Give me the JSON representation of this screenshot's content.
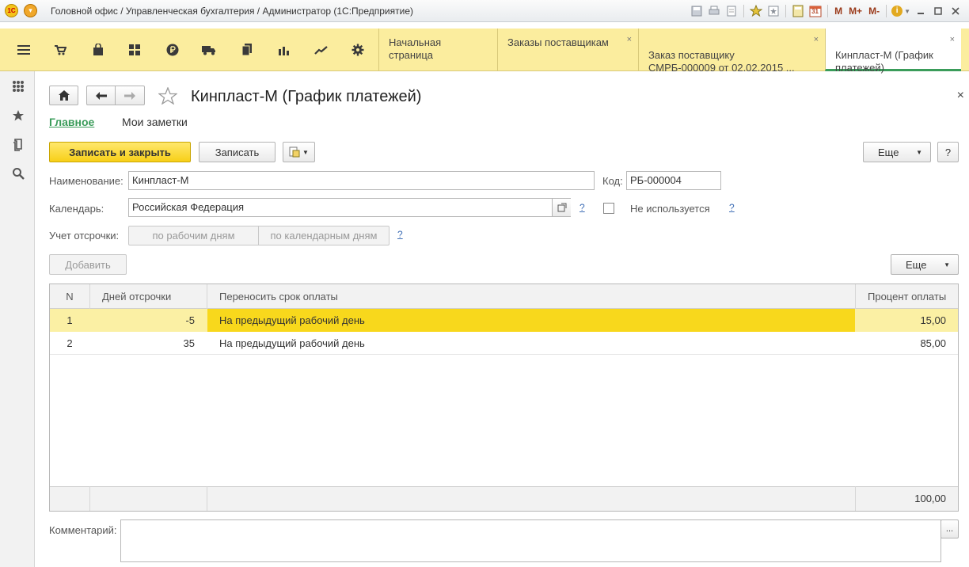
{
  "window": {
    "title": "Головной офис / Управленческая бухгалтерия / Администратор  (1С:Предприятие)",
    "logo_text": "1С",
    "toolbar_icons": [
      "save-icon",
      "print-icon",
      "preview-icon",
      "add-favorite-icon",
      "history-icon",
      "calculator-icon",
      "calendar-icon"
    ],
    "calendar_day": "31",
    "memory_labels": [
      "M",
      "M+",
      "M-"
    ],
    "info_icon": "i"
  },
  "sections": [
    "menu-icon",
    "cart-icon",
    "bag-icon",
    "grid-icon",
    "ruble-icon",
    "truck-icon",
    "documents-icon",
    "bar-chart-icon",
    "trend-icon",
    "gear-icon"
  ],
  "tabs": [
    {
      "label": "Начальная страница",
      "closable": false
    },
    {
      "label": "Заказы поставщикам",
      "closable": true
    },
    {
      "label": "Заказ поставщику\nСМРБ-000009 от 02.02.2015 ...",
      "closable": true
    },
    {
      "label": "Кинпласт-М (График\nплатежей)",
      "closable": true,
      "active": true
    }
  ],
  "close_glyph": "×",
  "form": {
    "title": "Кинпласт-М (График платежей)",
    "nav": {
      "main": "Главное",
      "notes": "Мои заметки"
    },
    "buttons": {
      "save_close": "Записать и закрыть",
      "save": "Записать",
      "more": "Еще",
      "help": "?",
      "add": "Добавить",
      "more2": "Еще"
    },
    "name_label": "Наименование:",
    "name_value": "Кинпласт-М",
    "code_label": "Код:",
    "code_value": "РБ-000004",
    "calendar_label": "Календарь:",
    "calendar_value": "Российская Федерация",
    "not_used_label": "Не используется",
    "delay_label": "Учет отсрочки:",
    "delay_option_work": "по рабочим дням",
    "delay_option_calendar": "по календарным дням",
    "help_mark": "?",
    "comment_label": "Комментарий:",
    "comment_value": "",
    "ellipsis": "..."
  },
  "table": {
    "columns": [
      "N",
      "Дней отсрочки",
      "Переносить срок оплаты",
      "Процент оплаты"
    ],
    "rows": [
      {
        "n": "1",
        "days": "-5",
        "transfer": "На предыдущий рабочий день",
        "percent": "15,00",
        "selected": true
      },
      {
        "n": "2",
        "days": "35",
        "transfer": "На предыдущий рабочий день",
        "percent": "85,00",
        "selected": false
      }
    ],
    "footer_total": "100,00"
  }
}
